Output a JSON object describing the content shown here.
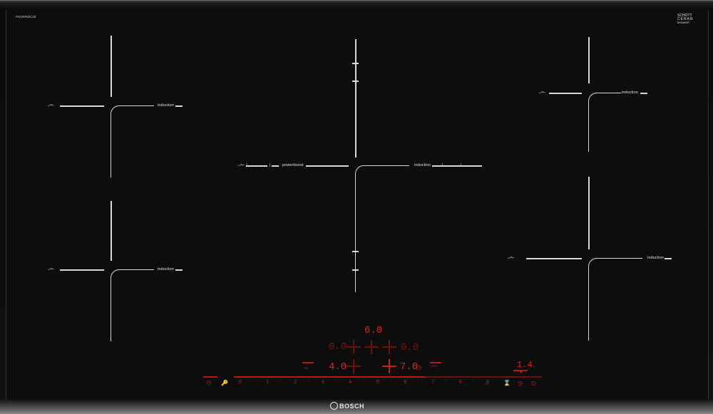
{
  "model_number": "PXV975DC1E",
  "glass_brand": {
    "line1": "SCHOTT",
    "line2": "CERAN",
    "line3": "BHXM00IT"
  },
  "brand": "BOSCH",
  "zones": {
    "top_left": {
      "label": "induction"
    },
    "bottom_left": {
      "label": "induction"
    },
    "center_left": {
      "label": "powerboost"
    },
    "center_right": {
      "label": "induction"
    },
    "top_right": {
      "label": "induction"
    },
    "bottom_right": {
      "label": "induction"
    }
  },
  "display": {
    "top_value": "6.0",
    "left_value": "0.0",
    "right_value": "0.0",
    "zone_a_value": "4.0",
    "zone_b_value": "7.0",
    "timer_value": "1.4"
  },
  "scale": {
    "numbers": [
      "0",
      "1",
      "2",
      "3",
      "4",
      "5",
      "6",
      "7",
      "8",
      "9"
    ],
    "ticks": [
      "'",
      "'",
      "'",
      "'",
      "'",
      "'",
      "'",
      "'",
      "'"
    ]
  },
  "icons": [
    "power-icon",
    "child-lock-icon",
    "keep-warm-icon",
    "wipe-protect-icon",
    "timer-icon",
    "clock-icon",
    "pan-detect-icon",
    "flex-icon"
  ],
  "colors": {
    "glass": "#0d0d0d",
    "marking": "#d8d8d8",
    "display_red": "#e02417"
  }
}
